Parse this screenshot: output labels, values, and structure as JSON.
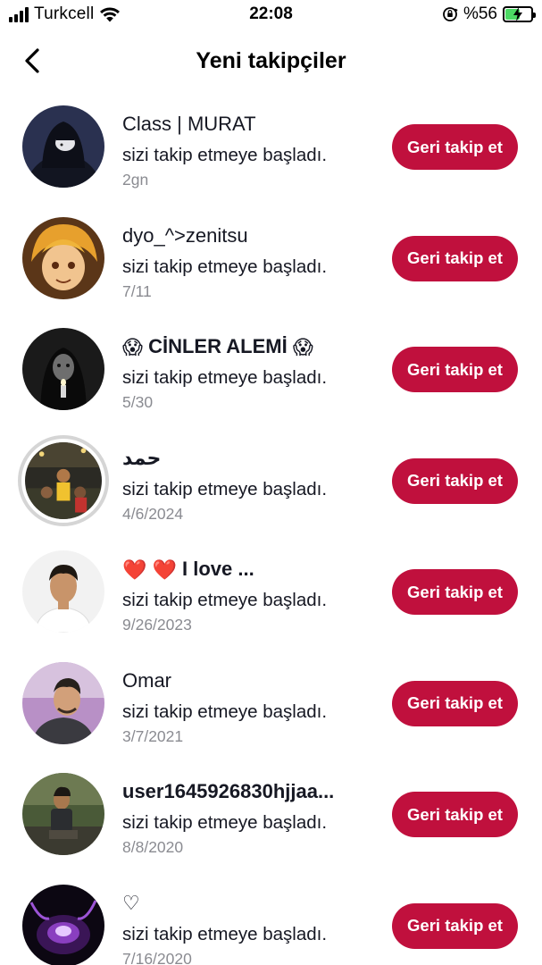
{
  "status_bar": {
    "carrier": "Turkcell",
    "time": "22:08",
    "battery_percent": "%56",
    "battery_level": 0.56,
    "icons": [
      "signal-icon",
      "wifi-icon",
      "rotation-lock-icon",
      "battery-charging-icon"
    ]
  },
  "header": {
    "back_icon": "chevron-left-icon",
    "title": "Yeni takipçiler"
  },
  "colors": {
    "button_bg": "#c0103d",
    "button_text": "#ffffff",
    "date_text": "#8a8b91",
    "battery_fill": "#4cd964"
  },
  "followers": [
    {
      "name": "Class | MURAT",
      "message": "sizi takip etmeye başladı.",
      "date": "2gn",
      "button": "Geri takip et",
      "avatar": "dark-hooded-figure-avatar"
    },
    {
      "name": "dyo_^>zenitsu",
      "message": "sizi takip etmeye başladı.",
      "date": "7/11",
      "button": "Geri takip et",
      "avatar": "anime-character-avatar"
    },
    {
      "name": "CİNLER ALEMİ",
      "name_emoji_left": "😱",
      "name_emoji_right": "😱",
      "message": "sizi takip etmeye başladı.",
      "date": "5/30",
      "button": "Geri takip et",
      "avatar": "dark-figure-candle-avatar"
    },
    {
      "name": "حمد",
      "message": "sizi takip etmeye başladı.",
      "date": "4/6/2024",
      "button": "Geri takip et",
      "avatar": "stadium-crowd-avatar",
      "story_ring": true
    },
    {
      "name": "I love ...",
      "name_prefix": "❤️ ❤️",
      "message": "sizi takip etmeye başladı.",
      "date": "9/26/2023",
      "button": "Geri takip et",
      "avatar": "young-man-portrait-avatar"
    },
    {
      "name": "Omar",
      "message": "sizi takip etmeye başladı.",
      "date": "3/7/2021",
      "button": "Geri takip et",
      "avatar": "man-selfie-avatar"
    },
    {
      "name": "user1645926830hjjaa...",
      "message": "sizi takip etmeye başladı.",
      "date": "8/8/2020",
      "button": "Geri takip et",
      "avatar": "man-sitting-outdoors-avatar"
    },
    {
      "name": "♡",
      "message": "sizi takip etmeye başladı.",
      "date": "7/16/2020",
      "button": "Geri takip et",
      "avatar": "purple-glow-avatar"
    }
  ]
}
